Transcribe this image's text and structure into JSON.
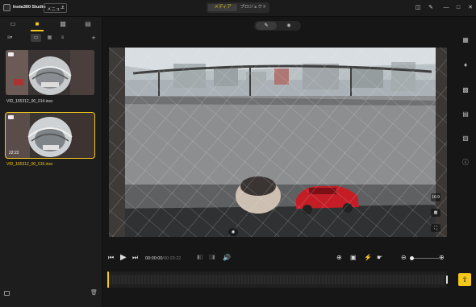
{
  "app": {
    "name": "Insta360 Studio",
    "menu_label": "メニュー"
  },
  "mode_tabs": [
    {
      "label": "メディア",
      "active": true
    },
    {
      "label": "プロジェクト",
      "active": false
    }
  ],
  "media": [
    {
      "filename": "VID_165312_00_014.insv",
      "duration": "",
      "selected": false
    },
    {
      "filename": "VID_165312_00_015.insv",
      "duration": "22:22",
      "selected": true
    }
  ],
  "player": {
    "current_time": "00:00:00",
    "total_time": "/00:23:22",
    "aspect_ratio": "16:9"
  },
  "colors": {
    "accent": "#f3c81b",
    "bg": "#161616",
    "panel": "#1d1d1d"
  }
}
